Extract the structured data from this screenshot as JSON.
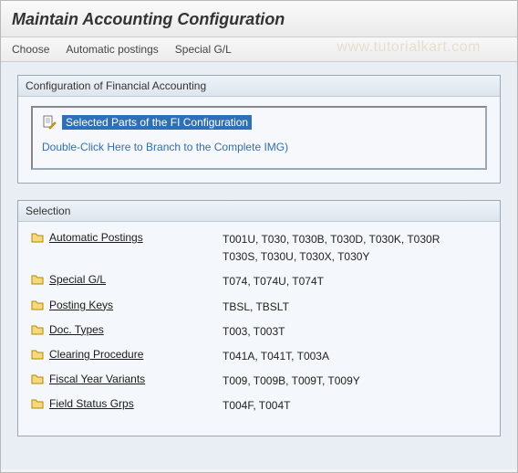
{
  "title": "Maintain Accounting Configuration",
  "menubar": {
    "choose": "Choose",
    "automatic_postings": "Automatic postings",
    "special_gl": "Special G/L",
    "watermark": "www.tutorialkart.com"
  },
  "config_panel": {
    "title": "Configuration of Financial Accounting",
    "selected_label": "Selected Parts of the FI Configuration",
    "branch_label": "Double-Click Here to Branch to the Complete IMG)"
  },
  "selection_panel": {
    "title": "Selection",
    "items": [
      {
        "label": "Automatic Postings",
        "tables": "T001U,  T030,   T030B,  T030D,  T030K,  T030R\nT030S,  T030U,  T030X,  T030Y"
      },
      {
        "label": "Special G/L",
        "tables": "T074,   T074U,  T074T"
      },
      {
        "label": "Posting Keys",
        "tables": "TBSL,   TBSLT"
      },
      {
        "label": "Doc. Types",
        "tables": "T003,   T003T"
      },
      {
        "label": "Clearing Procedure",
        "tables": "T041A,  T041T,  T003A"
      },
      {
        "label": "Fiscal Year Variants",
        "tables": "T009,   T009B,  T009T,  T009Y"
      },
      {
        "label": "Field Status Grps",
        "tables": "T004F,  T004T"
      }
    ]
  }
}
